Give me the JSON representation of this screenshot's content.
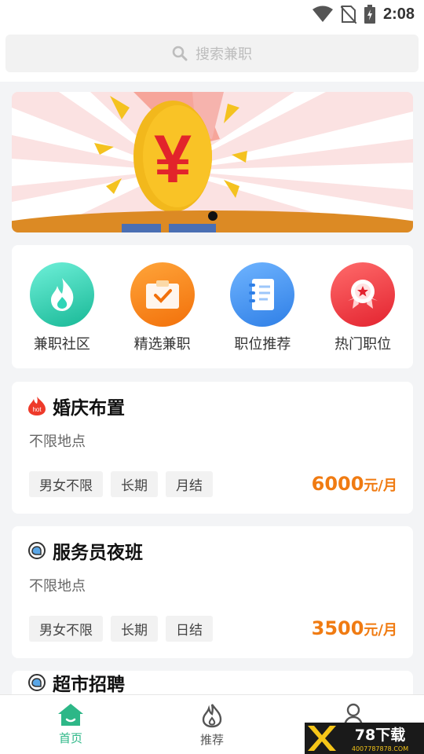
{
  "status": {
    "time": "2:08"
  },
  "search": {
    "placeholder": "搜索兼职"
  },
  "banner": {
    "symbol": "¥"
  },
  "categories": [
    {
      "label": "兼职社区",
      "icon": "flame-icon",
      "color": "#2fd5b7"
    },
    {
      "label": "精选兼职",
      "icon": "clipboard-check-icon",
      "color": "#fb8a1d"
    },
    {
      "label": "职位推荐",
      "icon": "notebook-icon",
      "color": "#4b96f3"
    },
    {
      "label": "热门职位",
      "icon": "award-ribbon-icon",
      "color": "#f2424f"
    }
  ],
  "jobs": [
    {
      "badge": "hot",
      "title": "婚庆布置",
      "location": "不限地点",
      "tags": [
        "男女不限",
        "长期",
        "月结"
      ],
      "amount": "6000",
      "unit": "元/月"
    },
    {
      "badge": "",
      "title": "服务员夜班",
      "location": "不限地点",
      "tags": [
        "男女不限",
        "长期",
        "日结"
      ],
      "amount": "3500",
      "unit": "元/月"
    },
    {
      "badge": "",
      "title": "超市招聘"
    }
  ],
  "tabs": {
    "home": "首页",
    "recommend": "推荐"
  },
  "watermark": {
    "brand": "78下载",
    "site": "4007787878.COM"
  },
  "colors": {
    "accent": "#2db787",
    "salary": "#f07b12"
  }
}
